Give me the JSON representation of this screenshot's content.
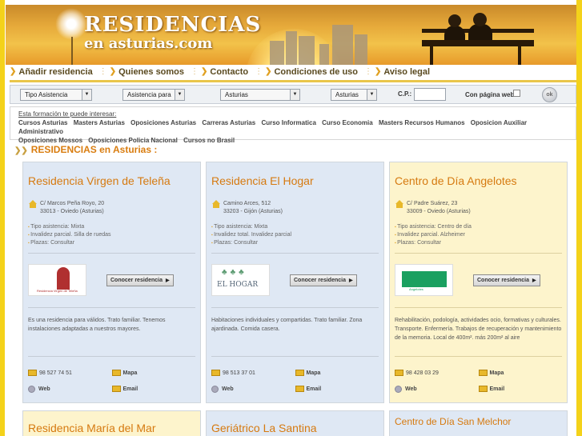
{
  "header": {
    "logo_line1": "RESIDENCIAS",
    "logo_line2": "en asturias.com"
  },
  "nav": {
    "items": [
      "Añadir residencia",
      "Quienes somos",
      "Contacto",
      "Condiciones de uso",
      "Aviso legal"
    ]
  },
  "search": {
    "tipo": "Tipo Asistencia",
    "asistencia": "Asistencia para",
    "region": "Asturias",
    "region2": "Asturias",
    "cp_label": "C.P.:",
    "cp_value": "",
    "web_label": "Con página web",
    "ok_label": "ok"
  },
  "training": {
    "title": "Esta formación te puede interesar:",
    "links": [
      "Cursos Asturias",
      "Masters Asturias",
      "Oposiciones Asturias",
      "Carreras Asturias",
      "Curso Informatica",
      "Curso Economia",
      "Masters Recursos Humanos",
      "Oposicion Auxiliar Administrativo",
      "Oposiciones Mossos",
      "Oposiciones Policia Nacional",
      "Cursos no Brasil"
    ]
  },
  "section": {
    "title": "RESIDENCIAS en Asturias :"
  },
  "cards": [
    {
      "name": "Residencia Virgen de Teleña",
      "addr1": "C/ Marcos Peña Royo, 20",
      "addr2": "33013 - Oviedo (Asturias)",
      "f1": "Tipo asistencia: Mixta",
      "f2": "Invalidez parcial. Silla de ruedas",
      "f3": "Plazas: Consultar",
      "button": "Conocer residencia",
      "desc": "Es una residencia para válidos. Trato familiar. Tenemos instalaciones adaptadas a nuestros mayores.",
      "phone": "98 527 74 51",
      "map": "Mapa",
      "web": "Web",
      "email": "Email",
      "logo_text": "Residencia Virgen de Teleña"
    },
    {
      "name": "Residencia El Hogar",
      "addr1": "Camino Arces, 512",
      "addr2": "33203 - Gijón (Asturias)",
      "f1": "Tipo asistencia: Mixta",
      "f2": "Invalidez total. Invalidez parcial",
      "f3": "Plazas: Consultar",
      "button": "Conocer residencia",
      "desc": "Habitaciones individuales y compartidas. Trato familiar. Zona ajardinada. Comida casera.",
      "phone": "98 513 37 01",
      "map": "Mapa",
      "web": "Web",
      "email": "Email",
      "logo_text": "EL HOGAR"
    },
    {
      "name": "Centro de Día Angelotes",
      "addr1": "C/ Padre Suárez, 23",
      "addr2": "33009 - Oviedo (Asturias)",
      "f1": "Tipo asistencia: Centro de día",
      "f2": "Invalidez parcial. Alzheimer",
      "f3": "Plazas: Consultar",
      "button": "Conocer residencia",
      "desc": "Rehabilitación, podología, actividades ocio, formativas y culturales. Transporte. Enfermería. Trabajos de recuperación y mantenimiento de la memoria. Local de 400m². más 200m² al aire",
      "phone": "98 428 03 29",
      "map": "Mapa",
      "web": "Web",
      "email": "Email",
      "logo_text": "Angelotes"
    }
  ],
  "bottom_cards": [
    {
      "name": "Residencia María del Mar"
    },
    {
      "name": "Geriátrico La Santina"
    },
    {
      "name": "Centro de Día San Melchor"
    }
  ],
  "colors": {
    "accent": "#d67a10",
    "card_blue": "#dfe8f4",
    "card_yellow": "#fdf4cc",
    "page_bg": "#f4d21a"
  }
}
